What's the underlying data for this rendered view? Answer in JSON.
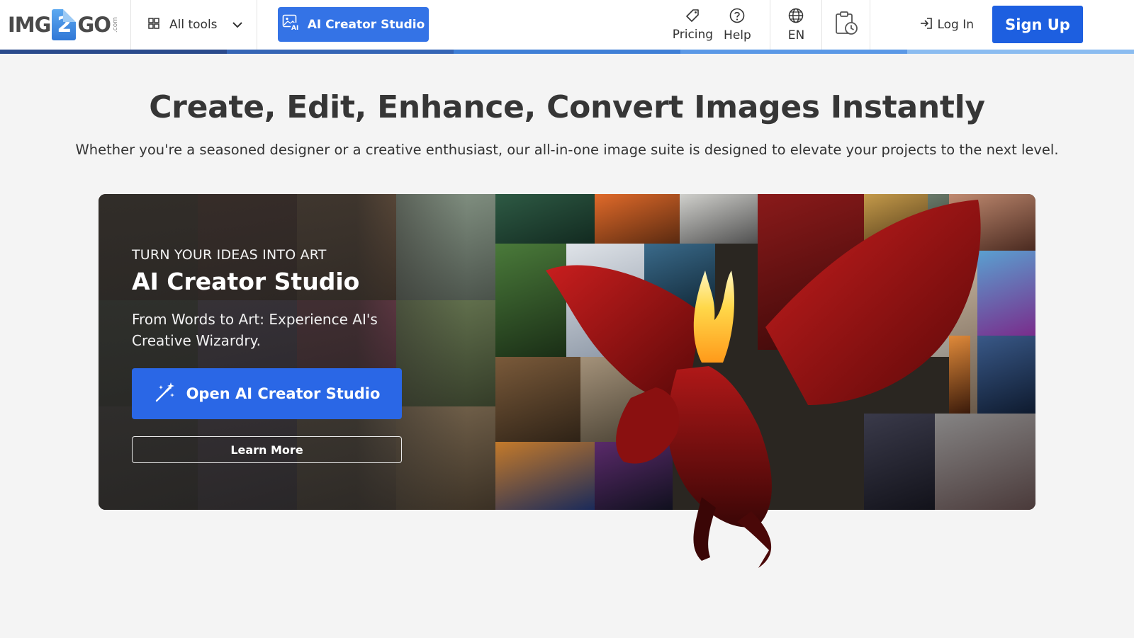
{
  "header": {
    "logo": {
      "prefix": "IMG",
      "digit": "2",
      "suffix": "GO",
      "tld": ".com"
    },
    "all_tools_label": "All tools",
    "ai_button_label": "AI Creator Studio",
    "pricing_label": "Pricing",
    "help_label": "Help",
    "language_label": "EN",
    "login_label": "Log In",
    "signup_label": "Sign Up"
  },
  "hero": {
    "title": "Create, Edit, Enhance, Convert Images Instantly",
    "subtitle": "Whether you're a seasoned designer or a creative enthusiast, our all-in-one image suite is designed to elevate your projects to the next level."
  },
  "banner": {
    "eyebrow": "TURN YOUR IDEAS INTO ART",
    "title": "AI Creator Studio",
    "description": "From Words to Art: Experience AI's Creative Wizardry.",
    "primary_button": "Open AI Creator Studio",
    "secondary_button": "Learn More"
  },
  "colors": {
    "accent": "#3473e6",
    "signup": "#1d5fe0",
    "stripe": [
      "#2a4a8c",
      "#3565b5",
      "#3f7fd6",
      "#5a98e6",
      "#8bbcf0"
    ],
    "page_bg": "#f4f4f4"
  },
  "icons": {
    "all_tools": "grid-icon",
    "chevron": "chevron-down-icon",
    "ai": "ai-image-icon",
    "pricing": "tag-icon",
    "help": "question-circle-icon",
    "language": "globe-icon",
    "history": "clipboard-clock-icon",
    "login": "login-arrow-icon",
    "magic": "magic-wand-icon"
  }
}
